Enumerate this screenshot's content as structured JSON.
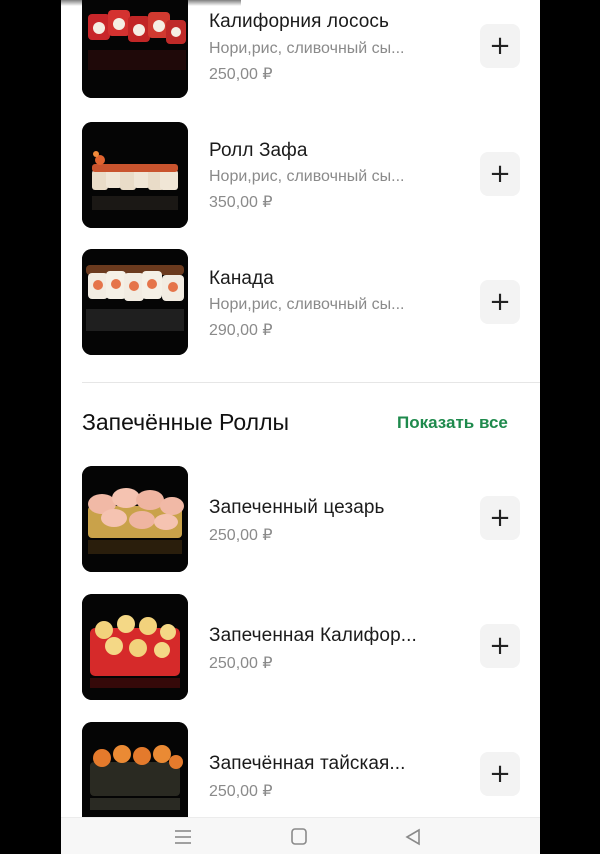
{
  "currency": "₽",
  "menu": {
    "top_items": [
      {
        "name": "Калифорния лосось",
        "description": "Нори,рис, сливочный сы...",
        "price": "250,00 ₽"
      },
      {
        "name": "Ролл Зафа",
        "description": "Нори,рис, сливочный сы...",
        "price": "350,00 ₽"
      },
      {
        "name": "Канада",
        "description": "Нори,рис, сливочный сы...",
        "price": "290,00 ₽"
      }
    ],
    "add_label": "+"
  },
  "baked_section": {
    "title": "Запечённые Роллы",
    "show_all": "Показать все",
    "items": [
      {
        "name": "Запеченный цезарь",
        "price": "250,00 ₽"
      },
      {
        "name": "Запеченная Калифор...",
        "price": "250,00 ₽"
      },
      {
        "name": "Запечённая тайская...",
        "price": "250,00 ₽"
      }
    ]
  },
  "colors": {
    "accent_green": "#1e8a4c",
    "text_primary": "#1b1b1b",
    "text_secondary": "#8a8a8a",
    "button_bg": "#f3f3f3"
  },
  "icons": {
    "nav_menu": "menu-icon",
    "nav_home": "home-square-icon",
    "nav_back": "back-triangle-icon",
    "add": "plus-icon"
  }
}
